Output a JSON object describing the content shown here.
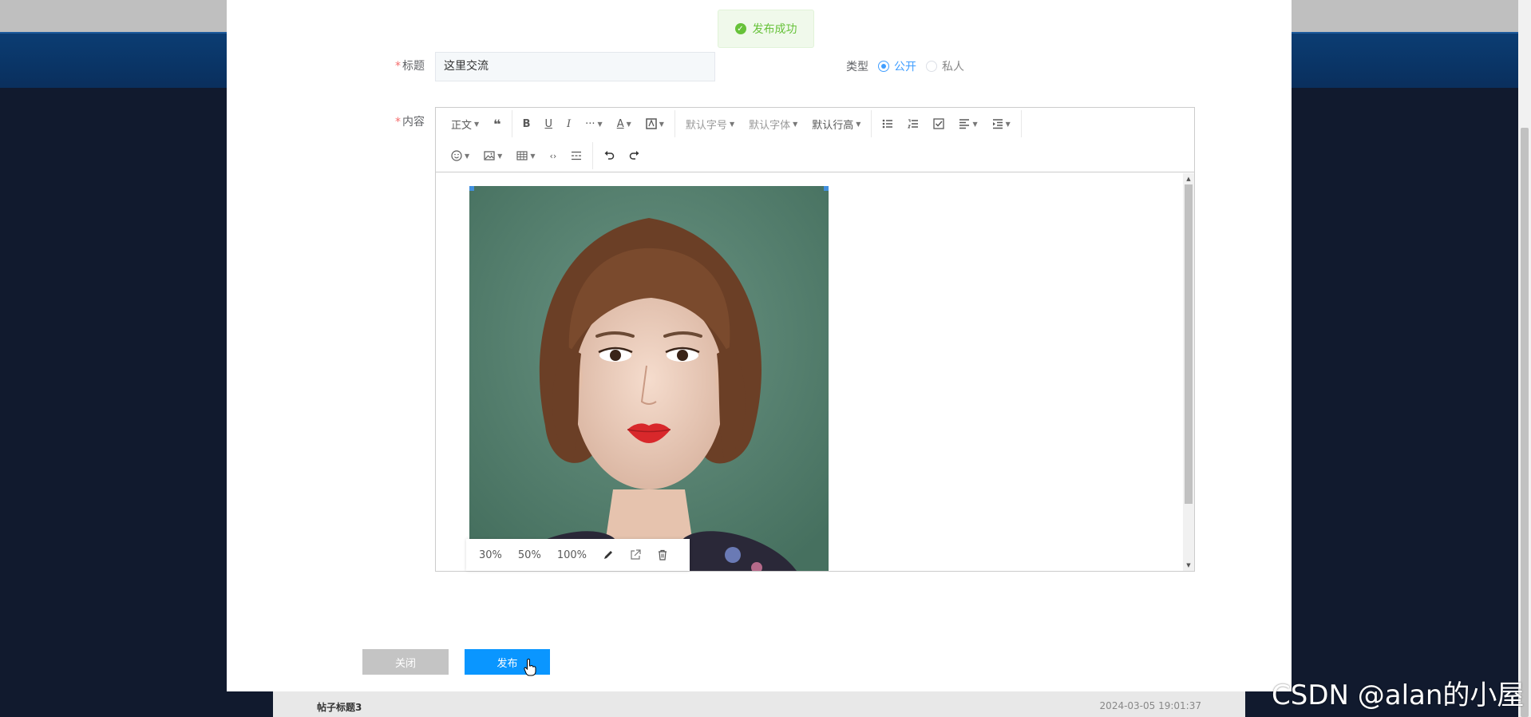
{
  "toast": {
    "text": "发布成功",
    "icon": "check-circle-icon",
    "color": "#67c23a"
  },
  "form": {
    "title_label": "标题",
    "title_value": "这里交流",
    "type_label": "类型",
    "type_options": [
      {
        "label": "公开",
        "checked": true
      },
      {
        "label": "私人",
        "checked": false
      }
    ],
    "content_label": "内容",
    "required_mark": "*"
  },
  "toolbar": {
    "row1": {
      "paragraph": "正文",
      "font_size": "默认字号",
      "font_family": "默认字体",
      "line_height": "默认行高"
    }
  },
  "image_toolbar": {
    "size_30": "30%",
    "size_50": "50%",
    "size_100": "100%"
  },
  "buttons": {
    "close": "关闭",
    "publish": "发布"
  },
  "background": {
    "post_title": "帖子标题3",
    "post_time": "2024-03-05 19:01:37"
  },
  "watermark": "CSDN @alan的小屋",
  "colors": {
    "primary": "#0a96ff",
    "radio_accent": "#409eff",
    "success": "#67c23a"
  }
}
